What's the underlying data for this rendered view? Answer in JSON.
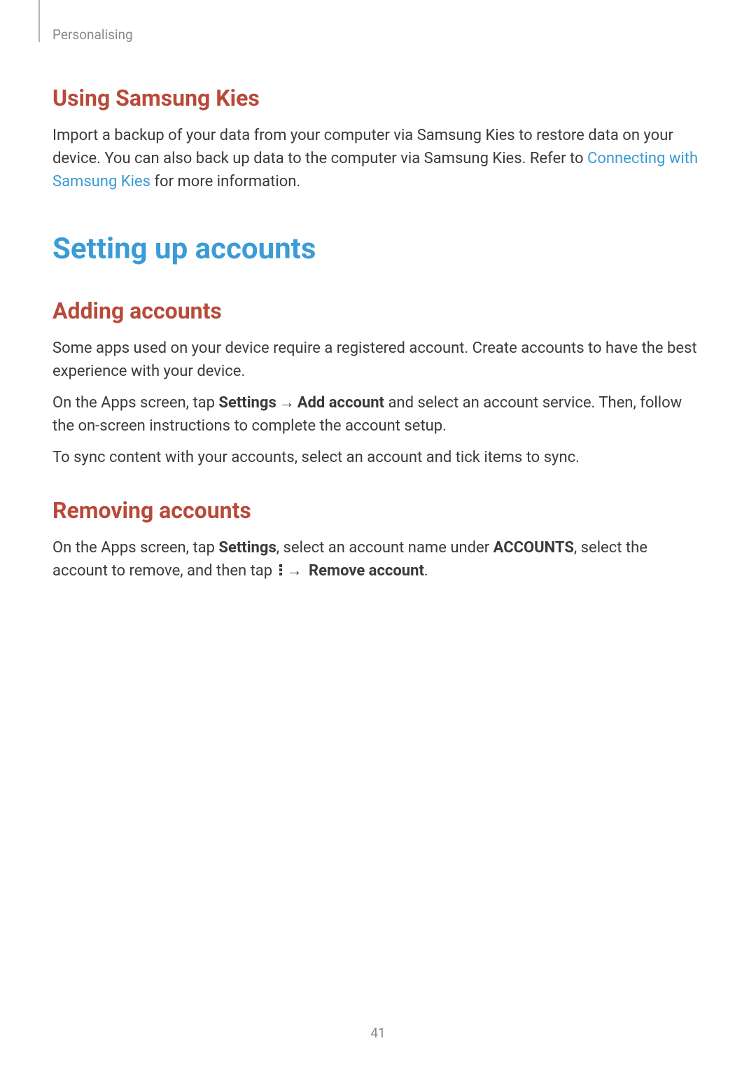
{
  "breadcrumb": "Personalising",
  "section_kies": {
    "heading": "Using Samsung Kies",
    "para1_pre": "Import a backup of your data from your computer via Samsung Kies to restore data on your device. You can also back up data to the computer via Samsung Kies. Refer to ",
    "link": "Connecting with Samsung Kies",
    "para1_post": " for more information."
  },
  "main_heading": "Setting up accounts",
  "section_add": {
    "heading": "Adding accounts",
    "para1": "Some apps used on your device require a registered account. Create accounts to have the best experience with your device.",
    "para2_pre": "On the Apps screen, tap ",
    "settings_label": "Settings",
    "arrow": "→",
    "add_account_label": "Add account",
    "para2_post": " and select an account service. Then, follow the on-screen instructions to complete the account setup.",
    "para3": "To sync content with your accounts, select an account and tick items to sync."
  },
  "section_remove": {
    "heading": "Removing accounts",
    "para_pre": "On the Apps screen, tap ",
    "settings_label": "Settings",
    "para_mid1": ", select an account name under ",
    "accounts_label": "ACCOUNTS",
    "para_mid2": ", select the account to remove, and then tap ",
    "arrow": "→",
    "remove_label": "Remove account",
    "para_post": "."
  },
  "page_number": "41"
}
